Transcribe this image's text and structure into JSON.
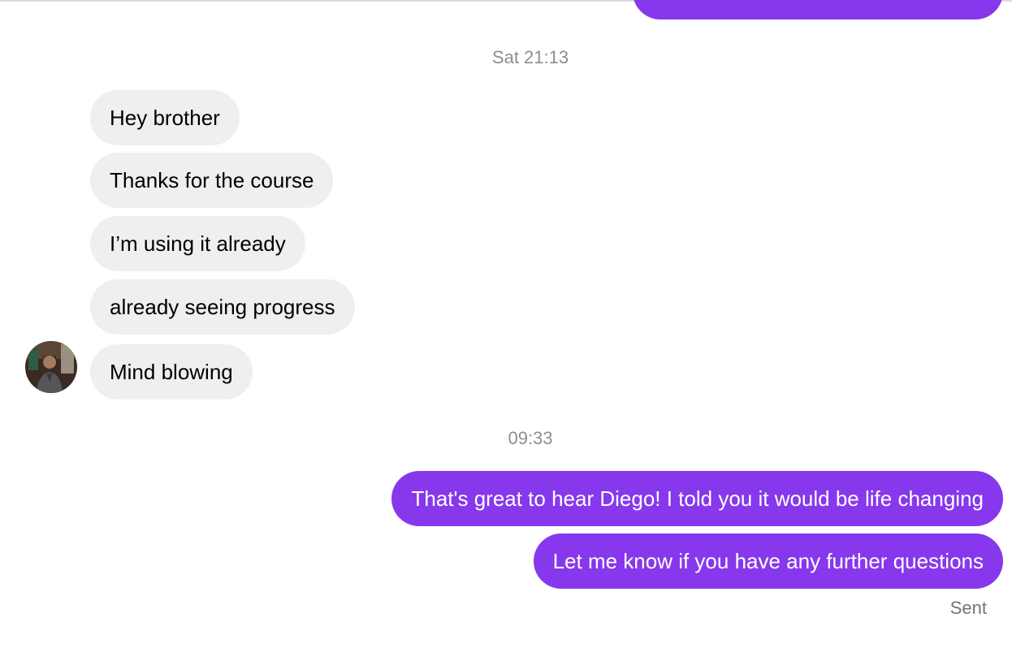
{
  "conversation": {
    "previous_outgoing_partial": "",
    "day_separator": "Sat 21:13",
    "incoming": [
      {
        "text": "Hey brother"
      },
      {
        "text": "Thanks for the course"
      },
      {
        "text": "I’m using it already"
      },
      {
        "text": "already seeing progress"
      },
      {
        "text": "Mind blowing"
      }
    ],
    "time_separator": "09:33",
    "outgoing": [
      {
        "text": "That's great to hear Diego! I told you it would be life changing"
      },
      {
        "text": "Let me know if you have any further questions"
      }
    ],
    "status": "Sent"
  },
  "colors": {
    "outgoing_bubble": "#8738ec",
    "incoming_bubble": "#efefef",
    "timestamp_text": "#8e8e8e",
    "status_text": "#737373"
  }
}
